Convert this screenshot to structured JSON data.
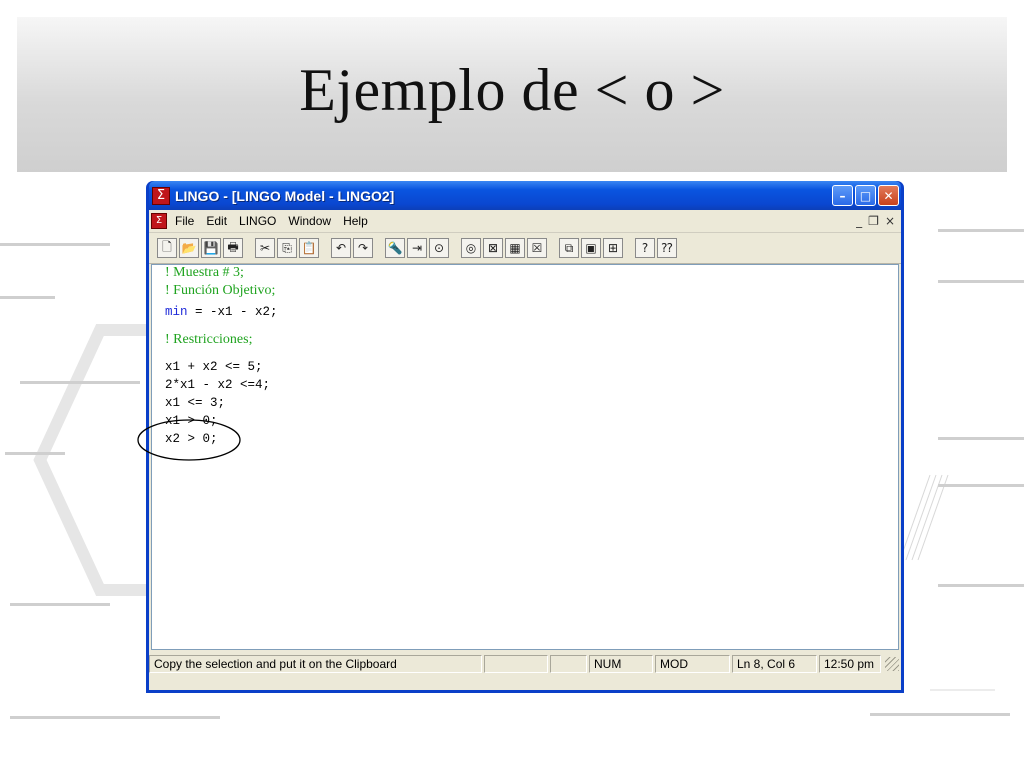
{
  "slide": {
    "title": "Ejemplo de < o >"
  },
  "window": {
    "title": "LINGO - [LINGO Model - LINGO2]",
    "minimize_label": "–",
    "maximize_label": "□",
    "close_label": "✕"
  },
  "menubar": {
    "items": [
      "File",
      "Edit",
      "LINGO",
      "Window",
      "Help"
    ],
    "mdi_min": "_",
    "mdi_restore": "❐",
    "mdi_close": "×"
  },
  "toolbar": {
    "icons": [
      "new-icon",
      "open-icon",
      "save-icon",
      "print-icon",
      "cut-icon",
      "copy-icon",
      "paste-icon",
      "undo-icon",
      "redo-icon",
      "find-icon",
      "go-to-line-icon",
      "match-parenthesis-icon",
      "solve-icon",
      "solution-icon",
      "matrix-picture-icon",
      "close-all-icon",
      "send-to-back-icon",
      "tile-icon",
      "options-icon",
      "help-topics-icon",
      "context-help-icon"
    ],
    "glyphs": [
      "🗋",
      "📂",
      "💾",
      "🖶",
      "✂",
      "⎘",
      "📋",
      "↶",
      "↷",
      "🔦",
      "⇥",
      "⊙",
      "◎",
      "⊠",
      "▦",
      "☒",
      "⧉",
      "▣",
      "⊞",
      "?",
      "⁇"
    ]
  },
  "editor": {
    "comment1": "! Muestra # 3;",
    "comment2": "! Función Objetivo;",
    "obj_kw": "min",
    "obj_rest": " = -x1 - x2;",
    "comment3": "! Restricciones;",
    "c1": "x1 + x2 <= 5;",
    "c2": "2*x1 - x2 <=4;",
    "c3": "x1 <= 3;",
    "c4": "x1 > 0;",
    "c5": "x2 > 0;"
  },
  "statusbar": {
    "message": "Copy the selection and put it on the Clipboard",
    "num": "NUM",
    "mod": "MOD",
    "position": "Ln 8, Col 6",
    "time": "12:50 pm"
  },
  "colors": {
    "titlebar": "#0a47d0",
    "comment": "#1fa31f",
    "keyword": "#1f2bd9",
    "annotation": "#000000"
  }
}
